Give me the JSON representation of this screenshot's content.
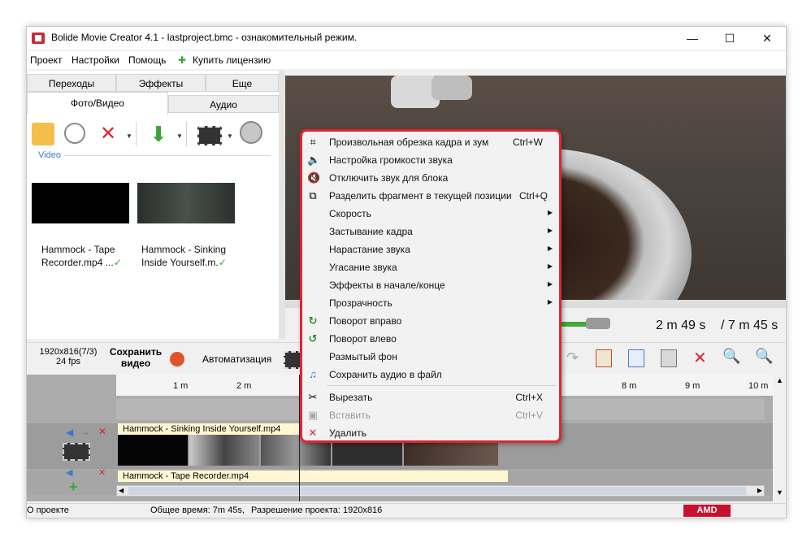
{
  "window": {
    "title": "Bolide Movie Creator 4.1 - lastproject.bmc  - ознакомительный режим.",
    "controls": {
      "minimize": "—",
      "maximize": "☐",
      "close": "✕"
    }
  },
  "menu": [
    "Проект",
    "Настройки",
    "Помощь",
    "Купить лицензию"
  ],
  "tabs_row1": [
    "Переходы",
    "Эффекты",
    "Еще"
  ],
  "tabs_row2": [
    "Фото/Видео",
    "Аудио"
  ],
  "media": {
    "section_label": "Video",
    "clips": [
      {
        "name_line1": "Hammock - Tape",
        "name_line2": "Recorder.mp4 ..."
      },
      {
        "name_line1": "Hammock - Sinking",
        "name_line2": "Inside Yourself.m."
      }
    ]
  },
  "player": {
    "current_time": "2 m 49 s",
    "total_time": "/ 7 m 45 s"
  },
  "bottom_toolbar": {
    "resolution": "1920x816(7/3)",
    "fps": "24 fps",
    "save_line1": "Сохранить",
    "save_line2": "видео",
    "automation": "Автоматизация"
  },
  "ruler_ticks": [
    "1 m",
    "2 m",
    "8 m",
    "9 m",
    "10 m"
  ],
  "timeline": {
    "clip1_label": "Hammock - Sinking Inside Yourself.mp4",
    "clip2_label": "Hammock - Tape Recorder.mp4"
  },
  "status": {
    "about": "О проекте",
    "total": "Общее время:  7m 45s,",
    "resolution": "Разрешение проекта:    1920x816",
    "badge": "AMD"
  },
  "context_menu": [
    {
      "icon": "crop-icon",
      "label": "Произвольная обрезка кадра и зум",
      "shortcut": "Ctrl+W"
    },
    {
      "icon": "volume-icon",
      "label": "Настройка громкости звука"
    },
    {
      "icon": "mute-icon",
      "label": "Отключить звук для блока"
    },
    {
      "icon": "split-icon",
      "label": "Разделить фрагмент в текущей позиции",
      "shortcut": "Ctrl+Q"
    },
    {
      "label": "Скорость",
      "submenu": true
    },
    {
      "label": "Застывание кадра",
      "submenu": true
    },
    {
      "label": "Нарастание звука",
      "submenu": true
    },
    {
      "label": "Угасание звука",
      "submenu": true
    },
    {
      "label": "Эффекты в начале/конце",
      "submenu": true
    },
    {
      "label": "Прозрачность",
      "submenu": true
    },
    {
      "icon": "rotate-right-icon",
      "label": "Поворот вправо"
    },
    {
      "icon": "rotate-left-icon",
      "label": "Поворот влево"
    },
    {
      "label": "Размытый фон"
    },
    {
      "icon": "save-audio-icon",
      "label": "Сохранить аудио в файл"
    },
    {
      "icon": "scissors-icon",
      "label": "Вырезать",
      "shortcut": "Ctrl+X"
    },
    {
      "icon": "paste-icon",
      "label": "Вставить",
      "shortcut": "Ctrl+V",
      "disabled": true
    },
    {
      "icon": "delete-icon",
      "label": "Удалить"
    }
  ]
}
